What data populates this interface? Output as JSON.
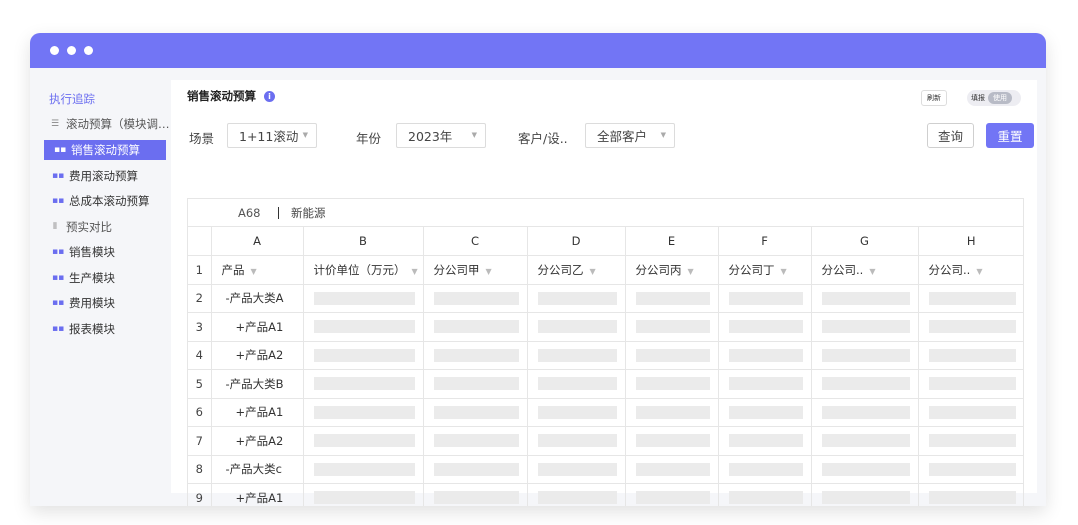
{
  "sidebar": {
    "items": [
      {
        "label": "执行追踪",
        "kind": "head"
      },
      {
        "label": "滚动预算（模块调…",
        "kind": "sub",
        "icon": "list-icon"
      },
      {
        "label": "销售滚动预算",
        "kind": "active",
        "icon": "grid-icon"
      },
      {
        "label": "费用滚动预算",
        "kind": "child",
        "icon": "grid-icon"
      },
      {
        "label": "总成本滚动预算",
        "kind": "child",
        "icon": "grid-icon"
      },
      {
        "label": "预实对比",
        "kind": "sub",
        "icon": "bars-icon"
      },
      {
        "label": "销售模块",
        "kind": "child",
        "icon": "grid-icon"
      },
      {
        "label": "生产模块",
        "kind": "child",
        "icon": "grid-icon"
      },
      {
        "label": "费用模块",
        "kind": "child",
        "icon": "grid-icon"
      },
      {
        "label": "报表模块",
        "kind": "child",
        "icon": "grid-icon"
      }
    ]
  },
  "header": {
    "title": "销售滚动预算",
    "refresh_label": "刷新",
    "toggle_label": "填报",
    "toggle_state": "使用"
  },
  "filters": {
    "scene_label": "场景",
    "scene_value": "1+11滚动",
    "year_label": "年份",
    "year_value": "2023年",
    "customer_label": "客户/设..",
    "customer_value": "全部客户",
    "query_label": "查询",
    "reset_label": "重置"
  },
  "sheet": {
    "cell_ref": "A68",
    "formula_value": "新能源",
    "columns": [
      "A",
      "B",
      "C",
      "D",
      "E",
      "F",
      "G",
      "H"
    ],
    "headers": [
      "产品",
      "计价单位（万元）",
      "分公司甲",
      "分公司乙",
      "分公司丙",
      "分公司丁",
      "分公司..",
      "分公司.."
    ],
    "rows": [
      {
        "num": "2",
        "product": "-产品大类A",
        "level": 1
      },
      {
        "num": "3",
        "product": "+产品A1",
        "level": 2
      },
      {
        "num": "4",
        "product": "+产品A2",
        "level": 2
      },
      {
        "num": "5",
        "product": "-产品大类B",
        "level": 1
      },
      {
        "num": "6",
        "product": "+产品A1",
        "level": 2
      },
      {
        "num": "7",
        "product": "+产品A2",
        "level": 2
      },
      {
        "num": "8",
        "product": "-产品大类c",
        "level": 1
      },
      {
        "num": "9",
        "product": "+产品A1",
        "level": 2
      }
    ],
    "header_row_num": "1"
  },
  "colors": {
    "accent": "#7275f5",
    "placeholder": "#ebebeb"
  }
}
